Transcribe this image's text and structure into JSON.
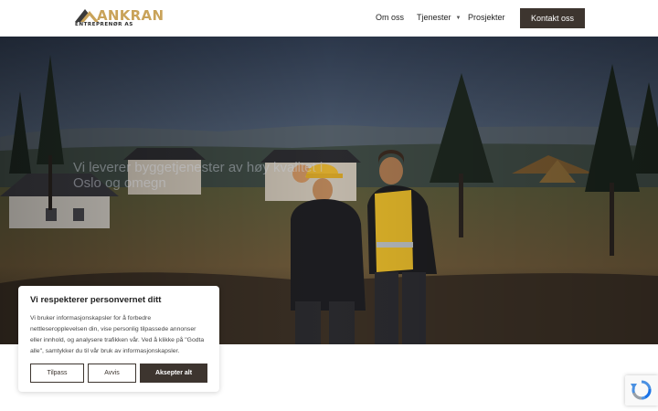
{
  "header": {
    "logo": {
      "word": "ANKRAN",
      "subtitle": "ENTREPRENØR AS"
    },
    "nav": [
      {
        "label": "Om oss"
      },
      {
        "label": "Tjenester",
        "has_dropdown": true
      },
      {
        "label": "Prosjekter"
      }
    ],
    "cta_label": "Kontakt oss"
  },
  "hero": {
    "headline": "Vi leverer byggetjenester av høy kvalitet i Oslo og omegn"
  },
  "cookie_banner": {
    "title": "Vi respekterer personvernet ditt",
    "body": "Vi bruker informasjonskapsler for å forbedre nettleseropplevelsen din, vise personlig tilpassede annonser eller innhold, og analysere trafikken vår. Ved å klikke på \"Godta alle\", samtykker du til vår bruk av informasjonskapsler.",
    "buttons": {
      "customize": "Tilpass",
      "reject": "Avvis",
      "accept": "Aksepter alt"
    }
  },
  "icons": {
    "recaptcha": "recaptcha-icon",
    "dropdown": "chevron-down-icon"
  },
  "colors": {
    "brand_gold": "#c9a35a",
    "brand_dark": "#3d352f"
  }
}
